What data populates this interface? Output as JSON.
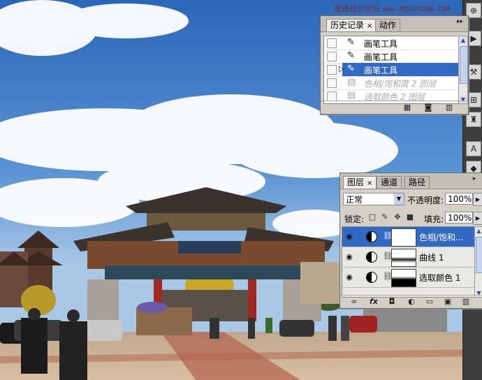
{
  "watermark": {
    "site": "思缘设计论坛",
    "url": "www.MISSYUAN.COM"
  },
  "history_panel": {
    "tabs": [
      {
        "label": "历史记录",
        "close": "×"
      },
      {
        "label": "动作"
      }
    ],
    "items": [
      {
        "label": "画笔工具",
        "icon": "brush-icon"
      },
      {
        "label": "画笔工具",
        "icon": "brush-icon"
      },
      {
        "label": "画笔工具",
        "icon": "brush-icon",
        "selected": true
      },
      {
        "label": "色相/饱和度 2 图层",
        "icon": "layer-icon",
        "dimmed": true
      },
      {
        "label": "选取颜色 2 图层",
        "icon": "layer-icon",
        "dimmed": true
      }
    ]
  },
  "layers_panel": {
    "tabs": [
      {
        "label": "图层",
        "close": "×"
      },
      {
        "label": "通道"
      },
      {
        "label": "路径"
      }
    ],
    "blend_mode": "正常",
    "opacity_label": "不透明度:",
    "opacity_value": "100%",
    "lock_label": "锁定:",
    "fill_label": "填充:",
    "fill_value": "100%",
    "layers": [
      {
        "name": "色相/饱和...",
        "selected": true
      },
      {
        "name": "曲线 1"
      },
      {
        "name": "选取颜色 1"
      }
    ],
    "footer_icons": [
      "link-icon",
      "fx-icon",
      "mask-icon",
      "adjustment-icon",
      "folder-icon",
      "new-layer-icon",
      "trash-icon"
    ]
  },
  "toolbox": {
    "tools": [
      "move-icon",
      "arrow-icon",
      "brush-icon",
      "crop-icon",
      "stamp-icon",
      "text-icon",
      "paint-icon"
    ]
  },
  "colors": {
    "selection": "#316ac5",
    "panel_bg": "#d4d0c8",
    "sky_top": "#2f6fc0",
    "plaza": "#c9a88a"
  }
}
